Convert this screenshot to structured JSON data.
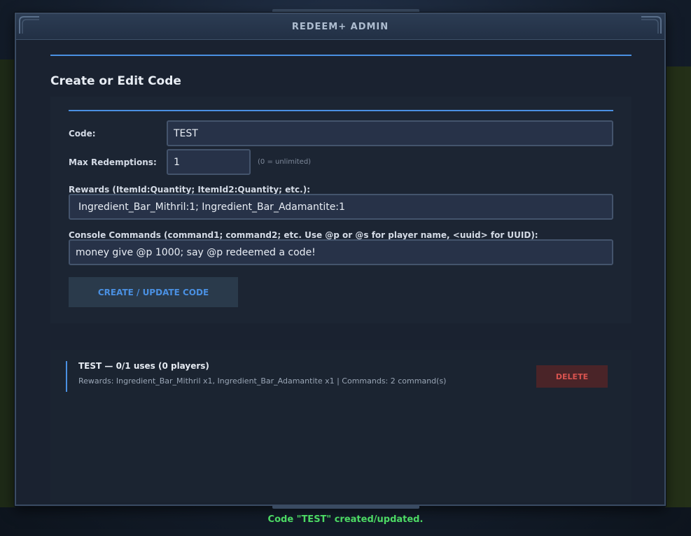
{
  "window": {
    "title": "REDEEM+ ADMIN"
  },
  "form": {
    "heading": "Create or Edit Code",
    "code_label": "Code:",
    "code_value": "TEST",
    "max_label": "Max Redemptions:",
    "max_value": "1",
    "max_hint": "(0 = unlimited)",
    "rewards_label": "Rewards (ItemId:Quantity; ItemId2:Quantity; etc.):",
    "rewards_value": "Ingredient_Bar_Mithril:1; Ingredient_Bar_Adamantite:1",
    "commands_label": "Console Commands (command1; command2; etc. Use @p or @s for player name, <uuid> for UUID):",
    "commands_value": "money give @p 1000; say @p redeemed a code!",
    "submit_label": "CREATE / UPDATE CODE"
  },
  "codes": [
    {
      "title": "TEST — 0/1 uses (0 players)",
      "details": "Rewards: Ingredient_Bar_Mithril x1, Ingredient_Bar_Adamantite x1 | Commands: 2 command(s)",
      "delete_label": "DELETE"
    }
  ],
  "status_message": "Code \"TEST\" created/updated.",
  "colors": {
    "accent": "#4a90e2",
    "success": "#4cd964",
    "danger": "#d9534f",
    "panel": "#1a2230"
  },
  "icons": [
    "corner-ornament-icon",
    "top-notch-icon"
  ]
}
